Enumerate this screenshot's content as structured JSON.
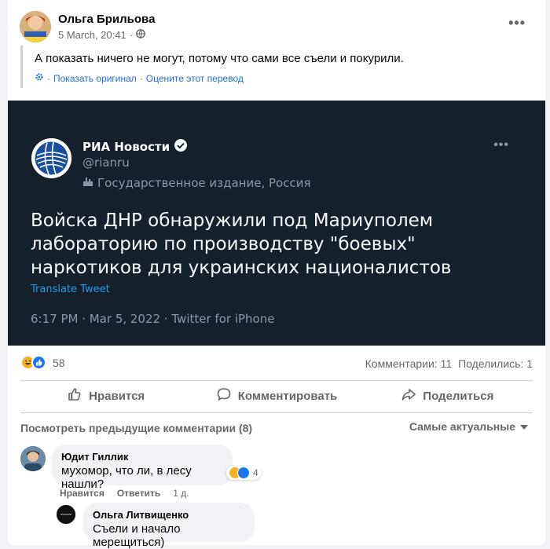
{
  "post": {
    "author": "Ольга Брильова",
    "date": "5 March, 20:41",
    "separator": "·",
    "text": "А показать ничего не могут, потому что сами все съели и покурили.",
    "show_original": "Показать оригинал",
    "rate_translation": "Оцените этот перевод",
    "more_label": "•••"
  },
  "tweet": {
    "name": "РИА Новости",
    "handle": "@rianru",
    "label": "Государственное издание, Россия",
    "text": "Войска ДНР обнаружили под Мариуполем лабораторию по производству \"боевых\" наркотиков для украинских националистов",
    "translate": "Translate Tweet",
    "time": "6:17 PM · Mar 5, 2022 · Twitter for iPhone",
    "more_label": "•••"
  },
  "reactions": {
    "count": "58",
    "comments": "Комментарии: 11",
    "shares": "Поделились: 1"
  },
  "actions": {
    "like": "Нравится",
    "comment": "Комментировать",
    "share": "Поделиться"
  },
  "comments_section": {
    "previous": "Посмотреть предыдущие комментарии (8)",
    "sort": "Самые актуальные"
  },
  "comments": [
    {
      "name": "Юдит Гиллик",
      "text": "мухомор, что ли, в лесу нашли?",
      "reaction_count": "4",
      "like": "Нравится",
      "reply": "Ответить",
      "time": "1 д."
    },
    {
      "name": "Ольга Литвищенко",
      "text": "Съели и начало мерещиться)"
    }
  ],
  "colors": {
    "tweet_bg": "#15202b",
    "link": "#216fdb",
    "twitter_blue": "#1d9bf0"
  }
}
